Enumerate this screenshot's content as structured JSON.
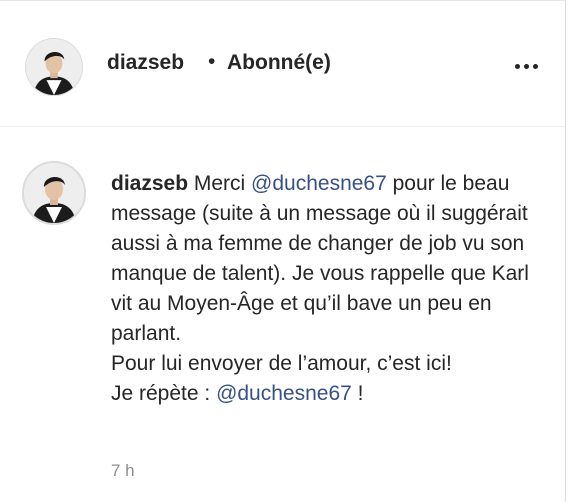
{
  "header": {
    "username": "diazseb",
    "separator": "•",
    "follow_status": "Abonné(e)",
    "more_icon": "more-horizontal-icon"
  },
  "comment": {
    "username": "diazseb",
    "text_1": " Merci ",
    "mention_1": "@duchesne67",
    "text_2": " pour le beau message (suite à un message où il suggérait aussi à ma femme de changer de job vu son manque de talent). Je vous rappelle que Karl vit au Moyen-Âge et qu’il bave un peu en parlant.",
    "text_3": "Pour lui envoyer de l’amour, c’est ici!",
    "text_4": "Je répète : ",
    "mention_2": "@duchesne67",
    "text_5": " !",
    "timestamp": "7 h"
  },
  "colors": {
    "text": "#262626",
    "mention": "#385185",
    "muted": "#8e8e8e",
    "divider": "#efefef"
  }
}
